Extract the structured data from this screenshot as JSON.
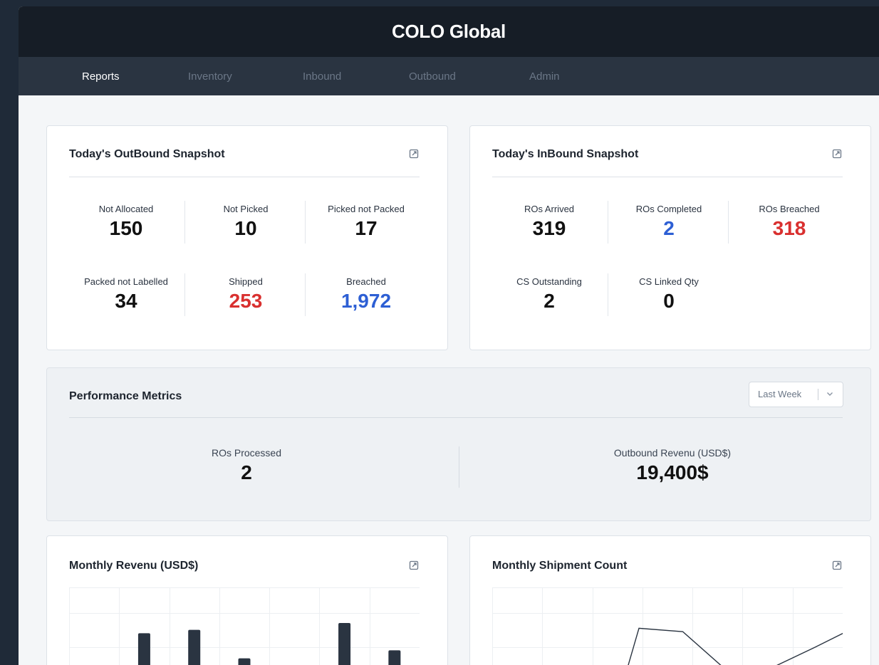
{
  "app": {
    "title": "COLO Global"
  },
  "nav": {
    "tabs": [
      {
        "label": "Reports",
        "active": true
      },
      {
        "label": "Inventory",
        "active": false
      },
      {
        "label": "Inbound",
        "active": false
      },
      {
        "label": "Outbound",
        "active": false
      },
      {
        "label": "Admin",
        "active": false
      }
    ]
  },
  "outbound": {
    "title": "Today's OutBound Snapshot",
    "stats": [
      {
        "label": "Not Allocated",
        "value": "150"
      },
      {
        "label": "Not Picked",
        "value": "10"
      },
      {
        "label": "Picked not Packed",
        "value": "17"
      },
      {
        "label": "Packed not Labelled",
        "value": "34"
      },
      {
        "label": "Shipped",
        "value": "253"
      },
      {
        "label": "Breached",
        "value": "1,972"
      }
    ]
  },
  "inbound": {
    "title": "Today's InBound Snapshot",
    "stats": [
      {
        "label": "ROs Arrived",
        "value": "319"
      },
      {
        "label": "ROs Completed",
        "value": "2"
      },
      {
        "label": "ROs Breached",
        "value": "318"
      },
      {
        "label": "CS Outstanding",
        "value": "2"
      },
      {
        "label": "CS Linked Qty",
        "value": "0"
      }
    ]
  },
  "performance": {
    "title": "Performance Metrics",
    "period": "Last Week",
    "stats": [
      {
        "label": "ROs Processed",
        "value": "2"
      },
      {
        "label": "Outbound Revenu (USD$)",
        "value": "19,400$"
      }
    ]
  },
  "monthly_revenue": {
    "title": "Monthly Revenu (USD$)"
  },
  "monthly_shipments": {
    "title": "Monthly Shipment Count"
  },
  "colors": {
    "accent_red": "#d9302f",
    "accent_blue": "#2d5fd4",
    "header_bg": "#161d26",
    "nav_bg": "#2a3441",
    "bar_color": "#2a3441"
  },
  "chart_data": [
    {
      "type": "bar",
      "title": "",
      "values": [
        null,
        0.82,
        0.88,
        0.38,
        null,
        1.0,
        0.52,
        null
      ],
      "note_values": "relative bar heights; chart is cut off at image bottom"
    },
    {
      "type": "line",
      "title": "",
      "values": [
        null,
        null,
        null,
        0.95,
        0.88,
        0.08,
        0.12,
        0.55,
        1.0
      ]
    }
  ]
}
